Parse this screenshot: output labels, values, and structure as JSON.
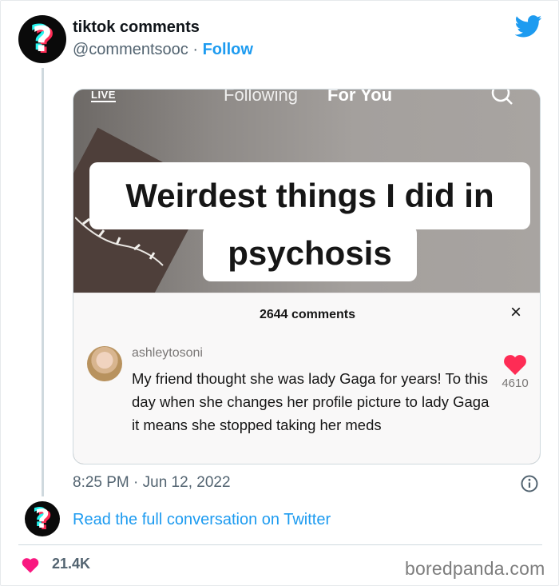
{
  "author": {
    "name": "tiktok comments",
    "handle": "@commentsooc",
    "separator": " · ",
    "follow_label": "Follow",
    "avatar_glyph": "?"
  },
  "icons": {
    "brand": "twitter-bird-icon",
    "search": "search-icon",
    "close": "close-icon",
    "like": "heart-icon",
    "info": "info-icon"
  },
  "colors": {
    "accent_blue": "#1d9bf0",
    "heart_red": "#f91880",
    "tiktok_heart": "#fe2c55",
    "tiktok_cyan": "#25f4ee"
  },
  "media": {
    "live_label": "LIVE",
    "tab_following": "Following",
    "tab_foryou": "For You",
    "caption_line1": "Weirdest things I did in",
    "caption_line2": "psychosis",
    "comments_count": "2644 comments",
    "close_glyph": "×",
    "comment": {
      "username": "ashleytosoni",
      "text": "My friend thought she was lady Gaga for years! To this day when she changes her profile picture to lady Gaga it means she stopped taking her meds",
      "likes": "4610"
    }
  },
  "tweet": {
    "timestamp": "8:25 PM · Jun 12, 2022",
    "read_link": "Read the full conversation on Twitter",
    "likes": "21.4K"
  },
  "watermark": "boredpanda.com"
}
